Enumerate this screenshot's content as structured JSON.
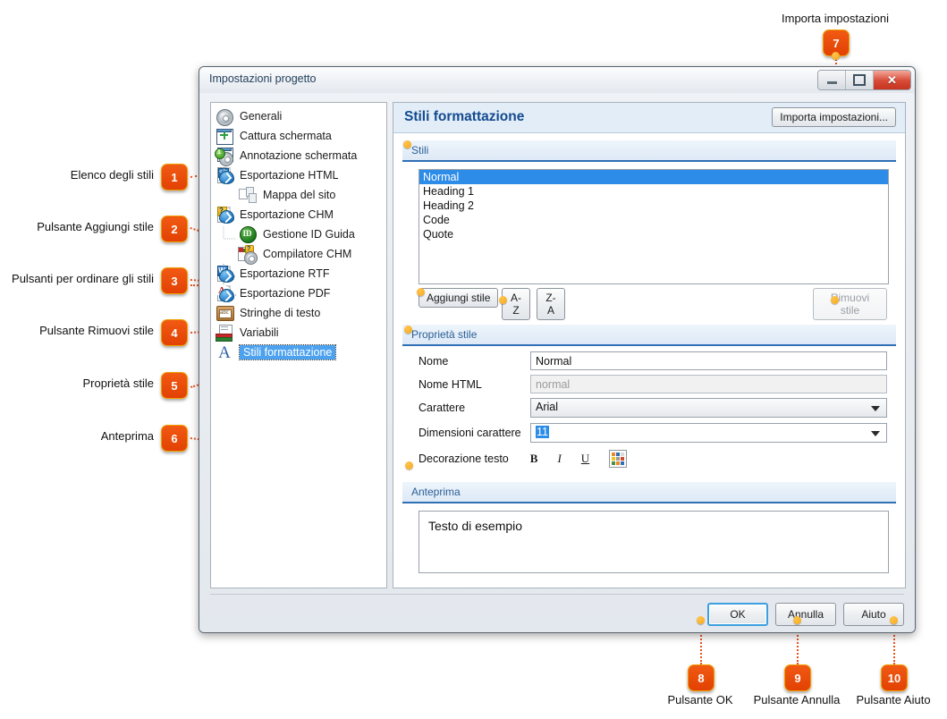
{
  "window": {
    "title": "Impostazioni progetto",
    "controls": [
      {
        "name": "minimize",
        "glyph": "minimize-icon"
      },
      {
        "name": "maximize",
        "glyph": "maximize-icon"
      },
      {
        "name": "close",
        "glyph": "✕"
      }
    ]
  },
  "tree": {
    "items": [
      {
        "label": "Generali",
        "icon": "gear-icon",
        "indent": 0,
        "selected": false
      },
      {
        "label": "Cattura schermata",
        "icon": "screen-capture-icon",
        "indent": 0,
        "selected": false
      },
      {
        "label": "Annotazione schermata",
        "icon": "screen-annotation-icon",
        "indent": 0,
        "selected": false
      },
      {
        "label": "Esportazione HTML",
        "icon": "html-export-icon",
        "indent": 0,
        "selected": false
      },
      {
        "label": "Mappa del sito",
        "icon": "sitemap-icon",
        "indent": 1,
        "selected": false
      },
      {
        "label": "Esportazione CHM",
        "icon": "chm-export-icon",
        "indent": 0,
        "selected": false
      },
      {
        "label": "Gestione ID Guida",
        "icon": "help-id-icon",
        "indent": 1,
        "selected": false
      },
      {
        "label": "Compilatore CHM",
        "icon": "chm-compiler-icon",
        "indent": 1,
        "selected": false
      },
      {
        "label": "Esportazione RTF",
        "icon": "rtf-export-icon",
        "indent": 0,
        "selected": false
      },
      {
        "label": "Esportazione PDF",
        "icon": "pdf-export-icon",
        "indent": 0,
        "selected": false
      },
      {
        "label": "Stringhe di testo",
        "icon": "text-strings-icon",
        "indent": 0,
        "selected": false
      },
      {
        "label": "Variabili",
        "icon": "variables-icon",
        "indent": 0,
        "selected": false
      },
      {
        "label": "Stili formattazione",
        "icon": "formatting-styles-icon",
        "indent": 0,
        "selected": true
      }
    ]
  },
  "panel": {
    "title": "Stili formattazione",
    "import_button": "Importa impostazioni...",
    "styles_section": {
      "label": "Stili",
      "list": [
        "Normal",
        "Heading 1",
        "Heading 2",
        "Code",
        "Quote"
      ],
      "selected_index": 0,
      "add_button": "Aggiungi stile",
      "sort_az_button": "A-Z",
      "sort_za_button": "Z-A",
      "remove_button": "Rimuovi stile",
      "remove_disabled": true
    },
    "properties_section": {
      "label": "Proprietà stile",
      "fields": [
        {
          "label": "Nome",
          "value": "Normal",
          "type": "text"
        },
        {
          "label": "Nome HTML",
          "value": "normal",
          "type": "text-readonly"
        },
        {
          "label": "Carattere",
          "value": "Arial",
          "type": "select"
        },
        {
          "label": "Dimensioni carattere",
          "value": "11",
          "type": "select-highlight"
        }
      ],
      "decoration_label": "Decorazione testo",
      "decoration_buttons": [
        {
          "name": "bold-icon",
          "glyph": "B"
        },
        {
          "name": "italic-icon",
          "glyph": "I"
        },
        {
          "name": "underline-icon",
          "glyph": "U"
        },
        {
          "name": "color-palette-icon",
          "glyph": ""
        }
      ]
    },
    "preview_section": {
      "label": "Anteprima",
      "text": "Testo di esempio"
    }
  },
  "footer": {
    "ok": "OK",
    "cancel": "Annulla",
    "help": "Aiuto"
  },
  "callouts": [
    {
      "n": "1",
      "label": "Elenco degli stili"
    },
    {
      "n": "2",
      "label": "Pulsante Aggiungi stile"
    },
    {
      "n": "3",
      "label": "Pulsanti per ordinare gli stili"
    },
    {
      "n": "4",
      "label": "Pulsante Rimuovi stile"
    },
    {
      "n": "5",
      "label": "Proprietà stile"
    },
    {
      "n": "6",
      "label": "Anteprima"
    },
    {
      "n": "7",
      "label": "Importa impostazioni"
    },
    {
      "n": "8",
      "label": "Pulsante OK"
    },
    {
      "n": "9",
      "label": "Pulsante Annulla"
    },
    {
      "n": "10",
      "label": "Pulsante Aiuto"
    }
  ],
  "colors": {
    "accent_orange": "#e8541f",
    "badge_orange": "#e24102",
    "heading_blue": "#134a8e",
    "selection_blue": "#2d8ce8",
    "section_rule": "#2f6fb5"
  }
}
